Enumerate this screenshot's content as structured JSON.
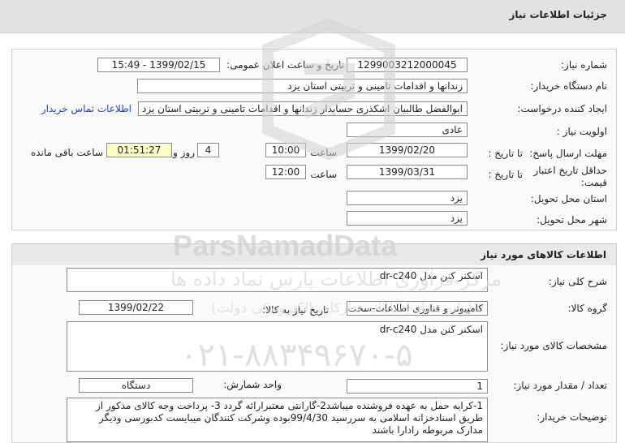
{
  "header": {
    "title": "جزئیات اطلاعات نیاز"
  },
  "info": {
    "need_number_label": "شماره نیاز:",
    "need_number": "1299003212000045",
    "announce_label": "تاریخ و ساعت اعلان عمومی:",
    "announce_value": "1399/02/15 - 15:49",
    "buyer_label": "نام دستگاه خریدار:",
    "buyer": "زندانها و اقدامات تامینی و تربیتی استان یزد",
    "creator_label": "ایجاد کننده درخواست:",
    "creator": "ابوالفضل  طالبیان اشکذری حسابدار زندانها و اقدامات تامینی و تربیتی استان یزد",
    "contact_link": "اطلاعات تماس خریدار",
    "priority_label": "اولویت نیاز :",
    "priority": "عادی",
    "deadline_label": "مهلت ارسال پاسخ:",
    "to_date_label": "تا تاریخ :",
    "deadline_date": "1399/02/20",
    "time_label": "ساعت",
    "deadline_time": "10:00",
    "days": "4",
    "days_label": "روز و",
    "remaining": "01:51:27",
    "remaining_label": "ساعت باقی مانده",
    "validity_label": "حداقل تاریخ اعتبار قیمت:",
    "validity_to_label": "تا تاریخ :",
    "validity_date": "1399/03/31",
    "validity_time_label": "ساعت",
    "validity_time": "12:00",
    "province_label": "استان محل تحویل:",
    "province": "یزد",
    "city_label": "شهر محل تحویل:",
    "city": "یزد"
  },
  "goods": {
    "section_title": "اطلاعات کالاهای مورد نیاز",
    "summary_label": "شرح کلی نیاز:",
    "summary": "اسکنر کنن مدل dr-c240",
    "group_label": "گروه کالا:",
    "group": "کامپیوتر و فناوری اطلاعات-سخت افزار",
    "need_date_label": "تاریخ نیاز به کالا:",
    "need_date": "1399/02/22",
    "spec_label": "مشخصات کالای مورد نیاز:",
    "spec": "اسکنر کنن مدل dr-c240",
    "qty_label": "تعداد / مقدار مورد نیاز:",
    "qty": "1",
    "unit_label": "واحد شمارش:",
    "unit": "دستگاه",
    "notes_label": "توضیحات خریدار:",
    "notes": "1-کرایه حمل به عهده فروشنده میباشد2-گارانتی معتبرارائه گردد 3- پرداخت وجه کالای مذکور از طریق اسنادخزانه اسلامی به سررسید 99/4/30بوده وشرکت کنندگان میبایست کدبورسی ودیگر مدارک مربوطه رادارا باشند"
  },
  "watermark": {
    "brand": "ParsNamadData",
    "tagline": "مرکز فرآوری اطلاعات پارس نماد داده ها",
    "subtitle": "سامانه ستاد (سامانه تدارکات الکترونیکی دولت)",
    "phone": "۰۲۱-۸۸۳۴۹۶۷۰-۵"
  },
  "colors": {
    "header_bg": "#e2e2e2",
    "panel_bg": "#fafafa",
    "link": "#1a3fc4",
    "highlight": "#ffffc8"
  }
}
